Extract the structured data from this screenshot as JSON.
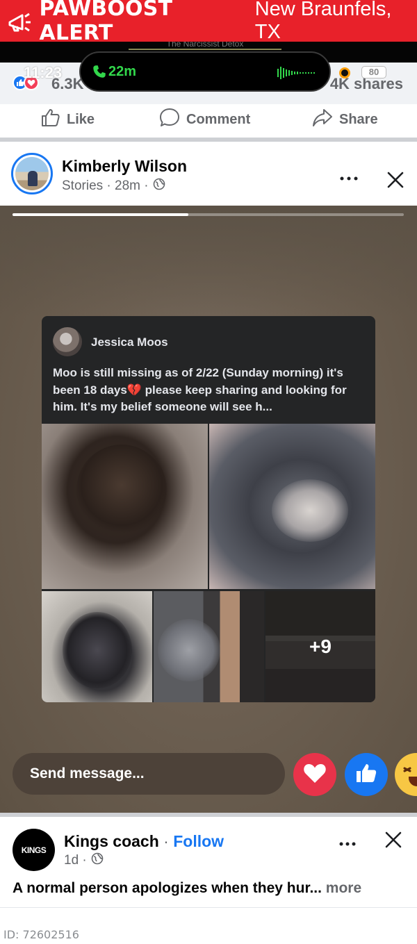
{
  "alert": {
    "title": "PAWBOOST ALERT",
    "location": "New Braunfels, TX",
    "background": "#e8212a"
  },
  "status_bar": {
    "time": "11:23",
    "call_timer": "22m",
    "battery": "80",
    "partial_text": "The Narcissist Detox"
  },
  "reactions": {
    "count": "6.3K",
    "shares": "4K shares"
  },
  "actions": {
    "like": "Like",
    "comment": "Comment",
    "share": "Share"
  },
  "post": {
    "author": "Kimberly Wilson",
    "meta": "Stories · 28m ·",
    "story_progress": 0.45
  },
  "shared_post": {
    "author": "Jessica Moos",
    "text": "Moo is still missing as of 2/22 (Sunday morning) it's been 18 days💔 please keep sharing and looking for him. It's my belief someone will see h...",
    "more_photos": "+9"
  },
  "message": {
    "placeholder": "Send message..."
  },
  "next_post": {
    "logo_text": "KINGS",
    "author": "Kings coach",
    "separator": " · ",
    "follow": "Follow",
    "meta": "1d ·",
    "text": "A normal person apologizes when they hur... ",
    "more": "more"
  },
  "footer": {
    "id_label": "ID: 72602516"
  },
  "colors": {
    "facebook_blue": "#1877f2",
    "love_red": "#f33e58",
    "call_green": "#32d74b"
  }
}
